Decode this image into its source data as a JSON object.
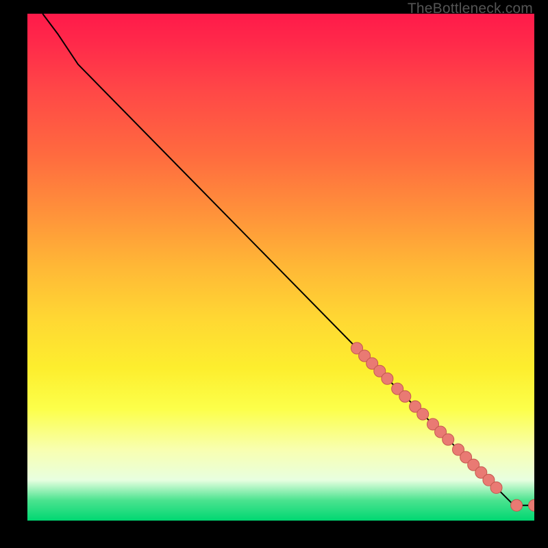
{
  "watermark": "TheBottleneck.com",
  "colors": {
    "dot_fill": "#e97a73",
    "dot_stroke": "#c4584f",
    "curve": "#000000",
    "grad_top": "#ff1a4a",
    "grad_bottom": "#00d772"
  },
  "chart_data": {
    "type": "line",
    "title": "",
    "xlabel": "",
    "ylabel": "",
    "xlim": [
      0,
      100
    ],
    "ylim": [
      0,
      100
    ],
    "curve": [
      {
        "x": 3,
        "y": 100
      },
      {
        "x": 6,
        "y": 96
      },
      {
        "x": 10,
        "y": 90
      },
      {
        "x": 65,
        "y": 34
      },
      {
        "x": 96,
        "y": 3
      },
      {
        "x": 100,
        "y": 3
      }
    ],
    "series": [
      {
        "name": "markers",
        "points": [
          {
            "x": 65.0,
            "y": 34.0
          },
          {
            "x": 66.5,
            "y": 32.5
          },
          {
            "x": 68.0,
            "y": 31.0
          },
          {
            "x": 69.5,
            "y": 29.5
          },
          {
            "x": 71.0,
            "y": 28.0
          },
          {
            "x": 73.0,
            "y": 26.0
          },
          {
            "x": 74.5,
            "y": 24.5
          },
          {
            "x": 76.5,
            "y": 22.5
          },
          {
            "x": 78.0,
            "y": 21.0
          },
          {
            "x": 80.0,
            "y": 19.0
          },
          {
            "x": 81.5,
            "y": 17.5
          },
          {
            "x": 83.0,
            "y": 16.0
          },
          {
            "x": 85.0,
            "y": 14.0
          },
          {
            "x": 86.5,
            "y": 12.5
          },
          {
            "x": 88.0,
            "y": 11.0
          },
          {
            "x": 89.5,
            "y": 9.5
          },
          {
            "x": 91.0,
            "y": 8.0
          },
          {
            "x": 92.5,
            "y": 6.5
          },
          {
            "x": 96.5,
            "y": 3.0
          },
          {
            "x": 100.0,
            "y": 3.0
          }
        ]
      }
    ]
  }
}
